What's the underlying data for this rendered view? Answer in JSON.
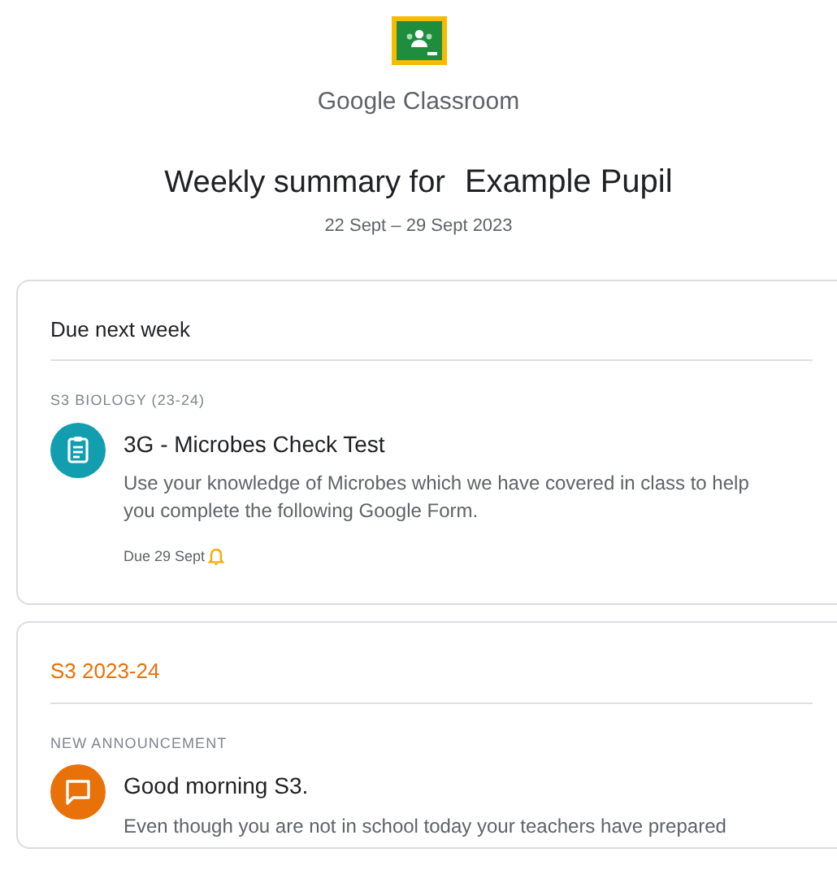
{
  "brand": "Google Classroom",
  "heading": {
    "prefix": "Weekly summary for",
    "name": "Example Pupil"
  },
  "date_range": "22 Sept – 29 Sept 2023",
  "sections": [
    {
      "title": "Due next week",
      "kind": "due",
      "label": "S3 BIOLOGY (23-24)",
      "item": {
        "kind": "assignment",
        "title": "3G - Microbes Check Test",
        "body": "Use your knowledge of Microbes which we have covered in class to help you complete the following Google Form.",
        "due": "Due 29 Sept"
      }
    },
    {
      "title": "S3 2023-24",
      "kind": "class",
      "label": "NEW ANNOUNCEMENT",
      "item": {
        "kind": "announcement",
        "title": "Good morning S3.",
        "body": "Even though you are not in school today your teachers have prepared"
      }
    }
  ]
}
